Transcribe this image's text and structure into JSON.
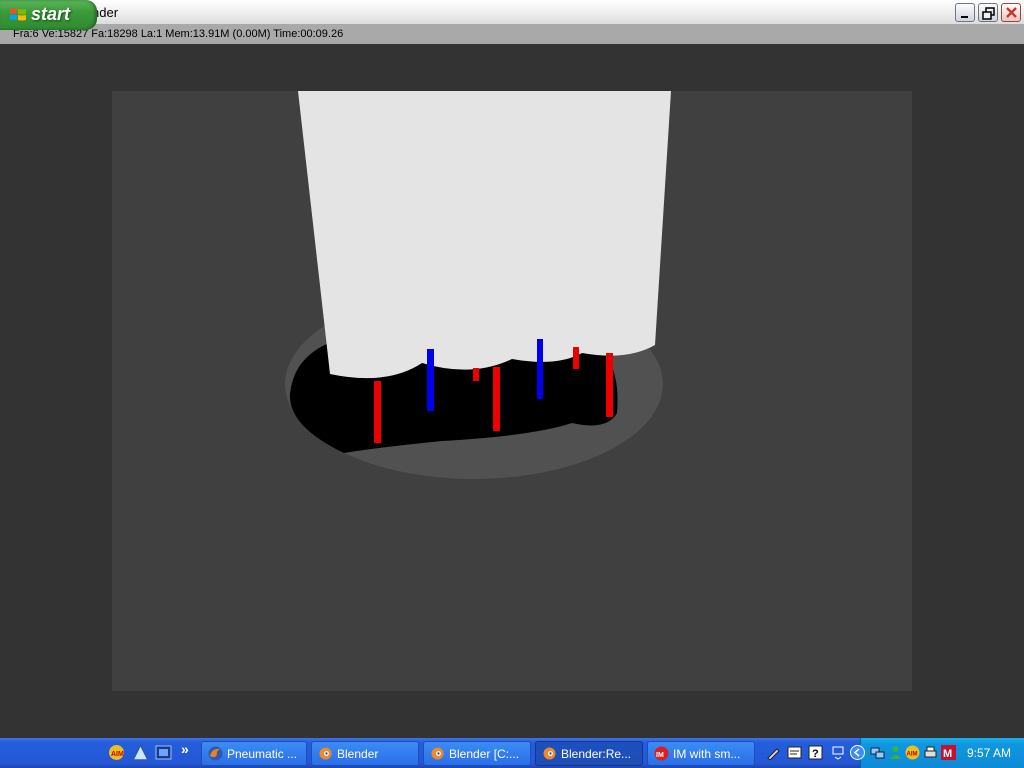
{
  "window": {
    "title": "Blender:Render",
    "status": "Fra:6  Ve:15827 Fa:18298 La:1 Mem:13.91M (0.00M) Time:00:09.26",
    "icon": "blender-icon"
  },
  "taskbar": {
    "start_label": "start",
    "quick_launch": [
      "aim-icon",
      "app-icon",
      "media-icon"
    ],
    "more_label": "»",
    "buttons": [
      {
        "label": "Pneumatic ...",
        "icon": "firefox-icon",
        "active": false
      },
      {
        "label": "Blender",
        "icon": "blender-icon",
        "active": false
      },
      {
        "label": "Blender [C:...",
        "icon": "blender-icon",
        "active": false
      },
      {
        "label": "Blender:Re...",
        "icon": "blender-icon",
        "active": true
      },
      {
        "label": "IM with sm...",
        "icon": "im-icon",
        "active": false
      }
    ],
    "clock": "9:57 AM"
  },
  "colors": {
    "background": "#333333",
    "canvas": "#404040",
    "cylinder": "#e4e4e4",
    "leg_red": "#ee0000",
    "leg_blue": "#0000ee"
  }
}
